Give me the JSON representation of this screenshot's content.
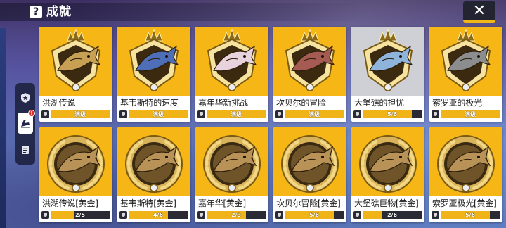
{
  "header": {
    "help_label": "?",
    "title": "成就",
    "close_label": "✕"
  },
  "side_tabs": [
    {
      "icon": "star-badge-icon"
    },
    {
      "icon": "fish-icon",
      "selected": true,
      "alert": "!"
    },
    {
      "icon": "book-icon"
    }
  ],
  "colors": {
    "card_gold": "#f5b616",
    "card_gray": "#cfd0d5",
    "progress_fill": "#f0b418",
    "progress_track": "#2a2a34"
  },
  "achievements": [
    {
      "name": "洪湖传说",
      "progress_text": "满级",
      "progress": 1.0,
      "fish": "#c7a053",
      "tone": "gold"
    },
    {
      "name": "基韦斯特的速度",
      "progress_text": "满级",
      "progress": 1.0,
      "fish": "#4e6fb8",
      "tone": "gold"
    },
    {
      "name": "嘉年华新挑战",
      "progress_text": "满级",
      "progress": 1.0,
      "fish": "#e8d2de",
      "tone": "gold"
    },
    {
      "name": "坎贝尔的冒险",
      "progress_text": "满级",
      "progress": 1.0,
      "fish": "#a55a52",
      "tone": "gold"
    },
    {
      "name": "大堡礁的担忧",
      "progress_text": "5/6",
      "progress": 0.83,
      "fish": "#8fb4dc",
      "tone": "gray"
    },
    {
      "name": "索罗亚的极光",
      "progress_text": "满级",
      "progress": 1.0,
      "fish": "#8c8d8e",
      "tone": "gold"
    },
    {
      "name": "洪湖传说[黄金]",
      "progress_text": "2/5",
      "progress": 0.4,
      "fish": "#b99258",
      "tone": "gold"
    },
    {
      "name": "基韦斯特[黄金]",
      "progress_text": "4/6",
      "progress": 0.67,
      "fish": "#b99258",
      "tone": "gold"
    },
    {
      "name": "嘉年华[黄金]",
      "progress_text": "2/3",
      "progress": 0.67,
      "fish": "#b99258",
      "tone": "gold"
    },
    {
      "name": "坎贝尔冒险[黄金]",
      "progress_text": "5/6",
      "progress": 0.83,
      "fish": "#b99258",
      "tone": "gold"
    },
    {
      "name": "大堡礁巨物[黄金]",
      "progress_text": "2/6",
      "progress": 0.33,
      "fish": "#b99258",
      "tone": "gold"
    },
    {
      "name": "索罗亚极光[黄金]",
      "progress_text": "5/6",
      "progress": 0.83,
      "fish": "#b99258",
      "tone": "gold"
    }
  ]
}
